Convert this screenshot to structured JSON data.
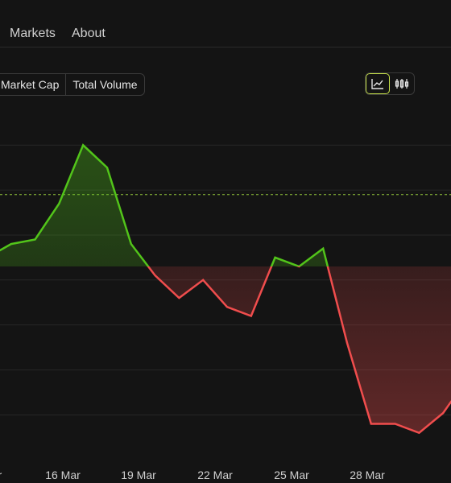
{
  "nav": {
    "markets": "Markets",
    "about": "About"
  },
  "chart_controls": {
    "metrics": [
      "Market Cap",
      "Total Volume"
    ],
    "view_toggle": [
      {
        "icon": "line-chart-icon",
        "active": true
      },
      {
        "icon": "candlestick-icon",
        "active": false
      }
    ]
  },
  "colors": {
    "up": "#52c41a",
    "down": "#f04d4d",
    "baseline": "#8fc23a",
    "accent": "#c7e24a"
  },
  "watermark_text": "",
  "chart_data": {
    "type": "area",
    "x_labels": [
      "r",
      "16 Mar",
      "19 Mar",
      "22 Mar",
      "25 Mar",
      "28 Mar"
    ],
    "values": [
      75,
      90,
      95,
      135,
      200,
      175,
      90,
      55,
      30,
      50,
      20,
      10,
      75,
      65,
      85,
      -20,
      -110,
      -110,
      -120,
      -98,
      -60
    ],
    "baseline_value": 65,
    "reference_value": 145,
    "ylim": [
      -140,
      245
    ],
    "y_grid": true
  }
}
